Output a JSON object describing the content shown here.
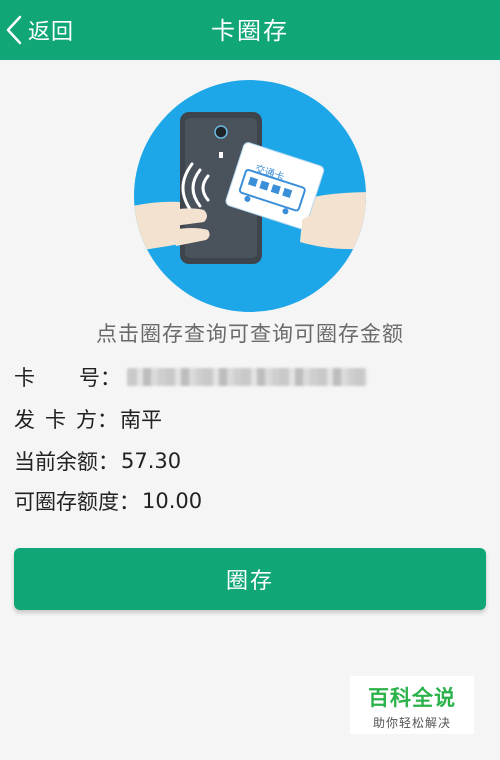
{
  "header": {
    "back_label": "返回",
    "title": "卡圈存"
  },
  "illustration": {
    "card_label": "交通卡"
  },
  "hint": "点击圈存查询可查询可圈存金额",
  "info": {
    "card_number_label": "卡号",
    "card_number_value": "",
    "issuer_label": "发卡方",
    "issuer_value": "南平",
    "balance_label": "当前余额",
    "balance_value": "57.30",
    "limit_label": "可圈存额度",
    "limit_value": "10.00"
  },
  "action": {
    "button_label": "圈存"
  },
  "watermark": {
    "title": "百科全说",
    "subtitle": "助你轻松解决"
  },
  "colors": {
    "primary": "#10a677",
    "circle": "#1ea7e8",
    "watermark_green": "#2cb24a"
  }
}
